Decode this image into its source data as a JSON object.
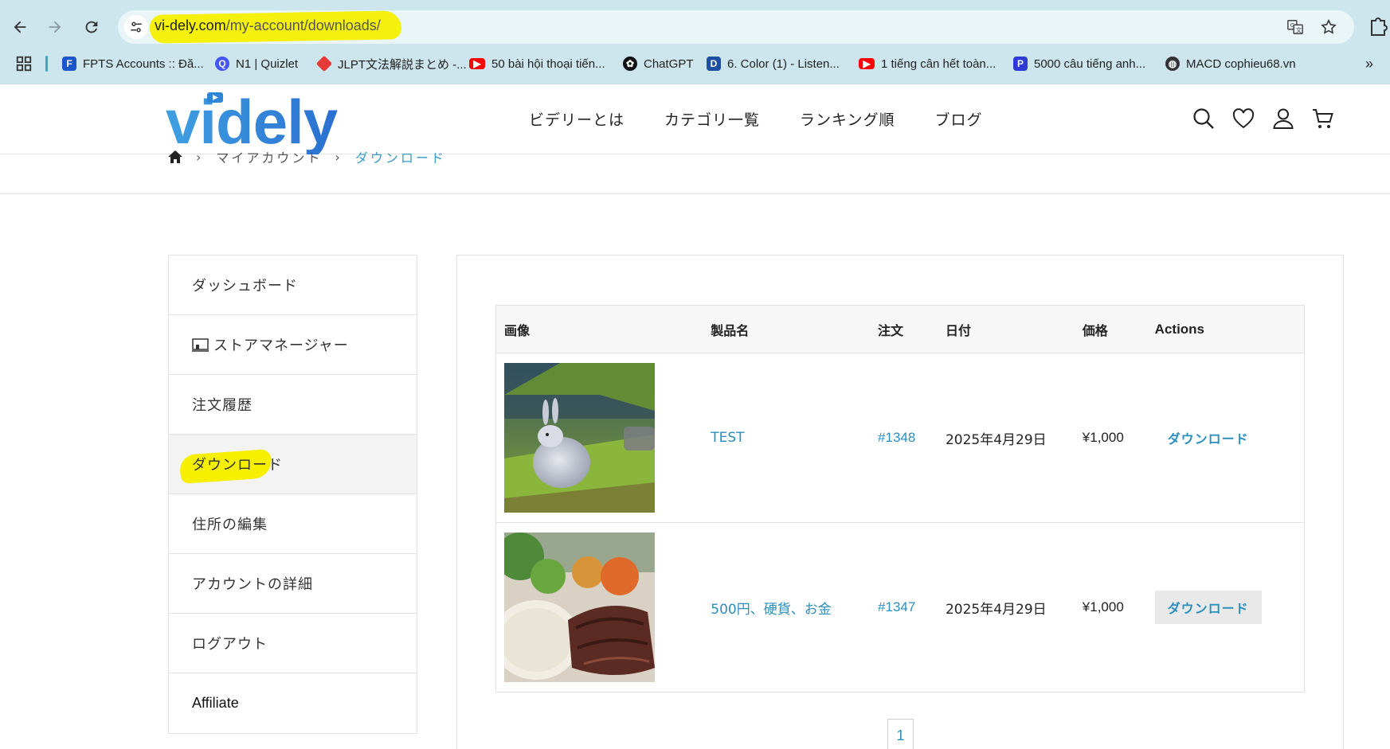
{
  "browser": {
    "url_host": "vi-dely.com",
    "url_path": "/my-account/downloads/",
    "bookmarks": [
      {
        "label": "FPTS Accounts :: Đă...",
        "icon": "fpts-icon",
        "color": "#1a56c8"
      },
      {
        "label": "N1 | Quizlet",
        "icon": "quizlet-icon",
        "color": "#4255ff"
      },
      {
        "label": "JLPT文法解説まとめ -...",
        "icon": "jlpt-icon",
        "color": "#e53935"
      },
      {
        "label": "50 bài hội thoại tiến...",
        "icon": "youtube-icon",
        "color": "#ff0000"
      },
      {
        "label": "ChatGPT",
        "icon": "chatgpt-icon",
        "color": "#111111"
      },
      {
        "label": "6. Color (1) - Listen...",
        "icon": "dictation-icon",
        "color": "#1e4fa0"
      },
      {
        "label": "1 tiếng cân hết toàn...",
        "icon": "youtube-icon",
        "color": "#ff0000"
      },
      {
        "label": "5000 câu tiếng anh...",
        "icon": "app-icon",
        "color": "#2f3ad6"
      },
      {
        "label": "MACD cophieu68.vn",
        "icon": "globe-icon",
        "color": "#333333"
      }
    ]
  },
  "site": {
    "logo_text": "videly",
    "nav": [
      "ビデリーとは",
      "カテゴリ一覧",
      "ランキング順",
      "ブログ"
    ],
    "brand_color": "#2f86d6"
  },
  "breadcrumb": {
    "items": [
      "マイアカウント",
      "ダウンロード"
    ]
  },
  "sidebar": {
    "items": [
      {
        "label": "ダッシュボード"
      },
      {
        "label": "ストアマネージャー"
      },
      {
        "label": "注文履歴"
      },
      {
        "label": "ダウンロード"
      },
      {
        "label": "住所の編集"
      },
      {
        "label": "アカウントの詳細"
      },
      {
        "label": "ログアウト"
      },
      {
        "label": "Affiliate"
      }
    ]
  },
  "table": {
    "headers": [
      "画像",
      "製品名",
      "注文",
      "日付",
      "価格",
      "Actions"
    ],
    "rows": [
      {
        "product": "TEST",
        "order": "#1348",
        "date": "2025年4月29日",
        "price": "¥1,000",
        "action": "ダウンロード"
      },
      {
        "product": "500円、硬貨、お金",
        "order": "#1347",
        "date": "2025年4月29日",
        "price": "¥1,000",
        "action": "ダウンロード"
      }
    ]
  },
  "pagination": {
    "current": "1"
  },
  "highlight_color": "#f6f000",
  "link_color": "#2b8fbd",
  "button_text_color": "#1d7a18"
}
